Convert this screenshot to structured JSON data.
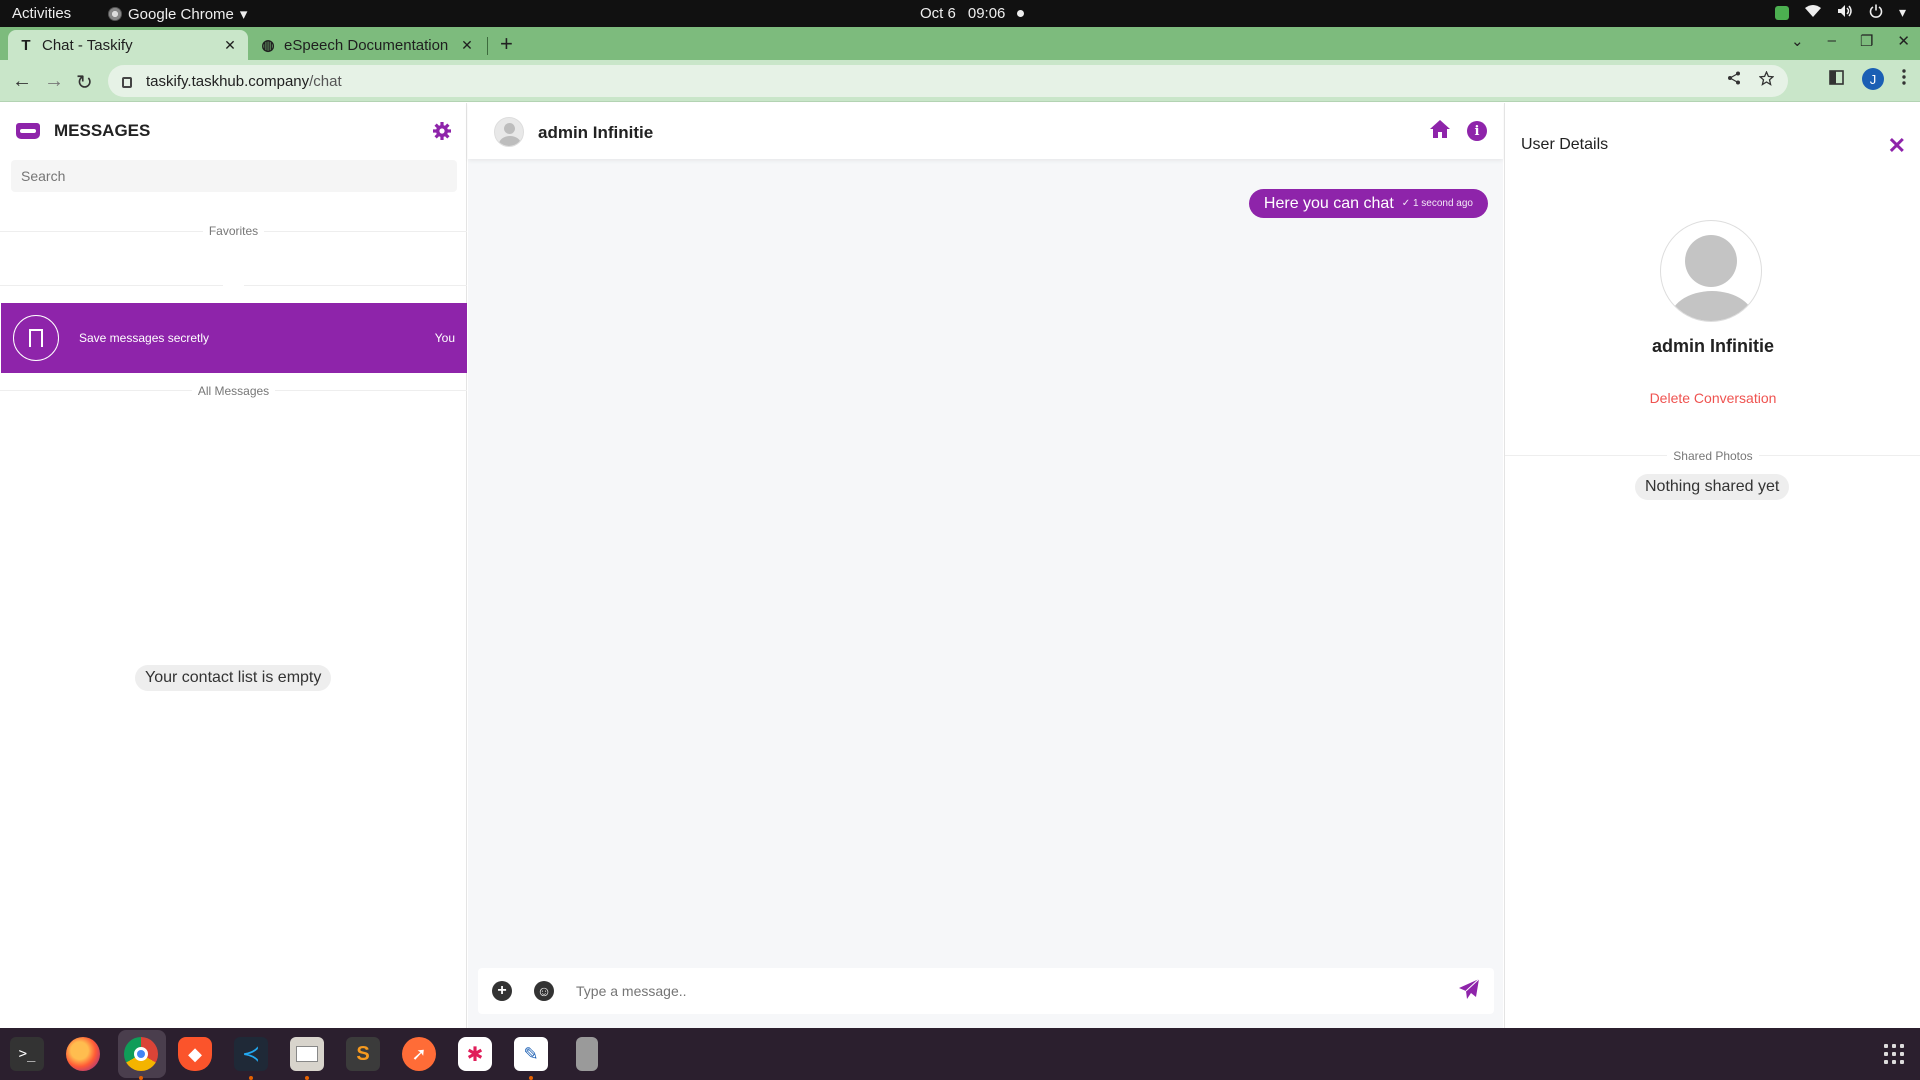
{
  "system": {
    "activities": "Activities",
    "app_name": "Google Chrome",
    "app_menu_arrow": "▾",
    "date": "Oct 6",
    "time": "09:06"
  },
  "browser": {
    "tabs": [
      {
        "favicon": "T",
        "title": "Chat - Taskify",
        "close": "✕"
      },
      {
        "favicon": "◍",
        "title": "eSpeech Documentation",
        "close": "✕"
      }
    ],
    "new_tab": "+",
    "url_host": "taskify.taskhub.company",
    "url_path": "/chat",
    "back": "←",
    "forward": "→",
    "reload": "↻",
    "profile_initial": "J",
    "window_controls": [
      "⌄",
      "–",
      "❐",
      "✕"
    ]
  },
  "messenger": {
    "title": "MESSAGES",
    "search_placeholder": "Search",
    "favorites_label": "Favorites",
    "saved_item": {
      "label": "Save messages secretly",
      "tag": "You"
    },
    "all_messages_label": "All Messages",
    "empty_contacts": "Your contact list is empty"
  },
  "chat": {
    "contact_name": "admin Infinitie",
    "messages": [
      {
        "text": "Here you can chat",
        "check": "✓",
        "time": "1 second ago"
      }
    ],
    "input_placeholder": "Type a message..",
    "info_glyph": "i",
    "plus_glyph": "+",
    "emoji_glyph": "☺"
  },
  "details": {
    "title": "User Details",
    "close_glyph": "✕",
    "name": "admin Infinitie",
    "delete_label": "Delete Conversation",
    "shared_photos_label": "Shared Photos",
    "nothing_shared": "Nothing shared yet"
  },
  "colors": {
    "accent": "#8e24aa",
    "danger": "#ef5350",
    "tabstrip": "#7dbb7d",
    "toolbar": "#c9e6c9"
  },
  "dock_apps": [
    "terminal",
    "firefox",
    "chrome",
    "brave",
    "vscode",
    "files",
    "sublime",
    "postman",
    "slack",
    "text-editor",
    "usb-drive"
  ]
}
